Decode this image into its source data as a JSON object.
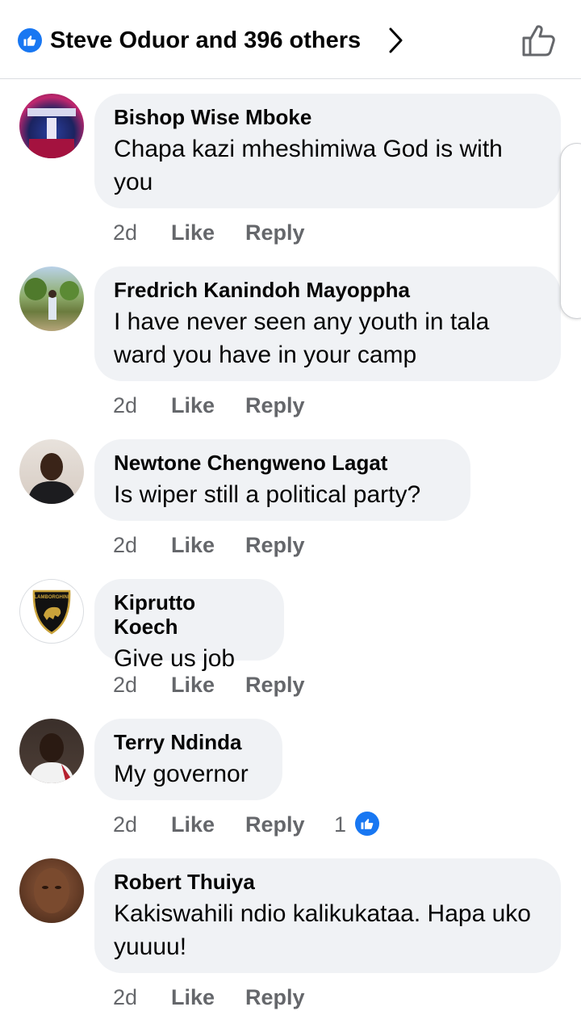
{
  "header": {
    "reactors_label": "Steve Oduor and 396 others"
  },
  "comments": [
    {
      "author": "Bishop Wise Mboke",
      "text": "Chapa kazi mheshimiwa God is with you",
      "time": "2d",
      "like_label": "Like",
      "reply_label": "Reply"
    },
    {
      "author": "Fredrich Kanindoh Mayoppha",
      "text": "I have never seen any youth in tala ward you have in your camp",
      "time": "2d",
      "like_label": "Like",
      "reply_label": "Reply"
    },
    {
      "author": "Newtone Chengweno Lagat",
      "text": "Is wiper still a political party?",
      "time": "2d",
      "like_label": "Like",
      "reply_label": "Reply"
    },
    {
      "author": "Kiprutto Koech",
      "text": "Give us job",
      "time": "2d",
      "like_label": "Like",
      "reply_label": "Reply",
      "avatar_text": "LAMBORGHINI"
    },
    {
      "author": "Terry Ndinda",
      "text": "My governor",
      "time": "2d",
      "like_label": "Like",
      "reply_label": "Reply",
      "reaction_count": "1"
    },
    {
      "author": "Robert Thuiya",
      "text": "Kakiswahili ndio kalikukataa. Hapa uko yuuuu!",
      "time": "2d",
      "like_label": "Like",
      "reply_label": "Reply"
    }
  ],
  "icons": {
    "header_badge": "thumbs-up-icon",
    "chevron": "chevron-right-icon",
    "like_button": "thumbs-up-outline-icon",
    "reaction_badge": "thumbs-up-icon"
  },
  "colors": {
    "accent": "#1877f2",
    "bubble": "#f0f2f5",
    "meta_text": "#65676b"
  }
}
